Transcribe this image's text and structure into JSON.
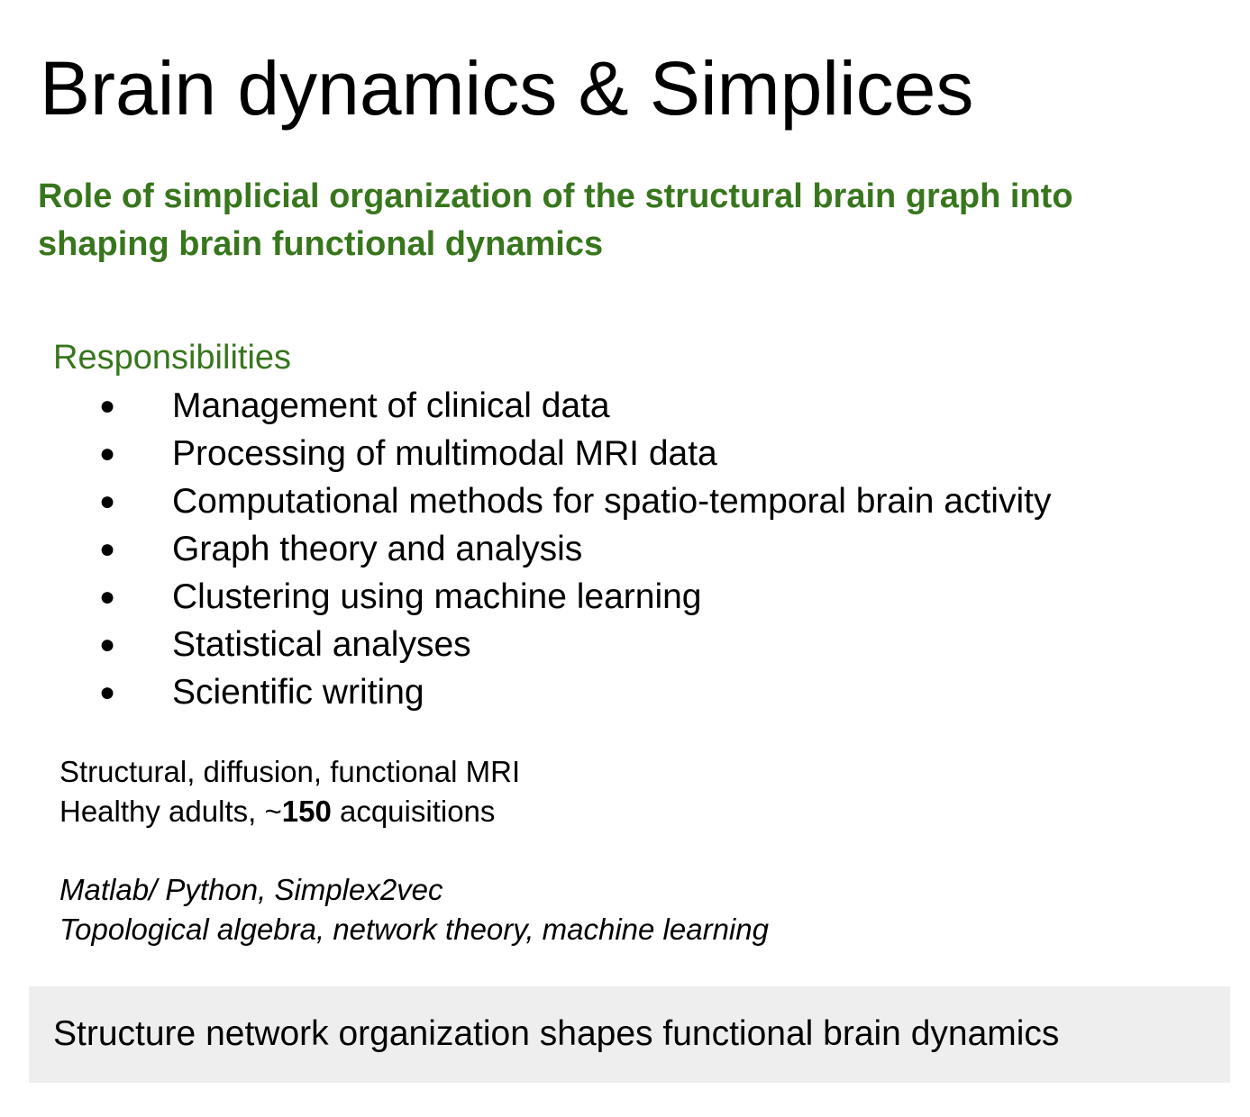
{
  "title": "Brain dynamics & Simplices",
  "subtitle": "Role of simplicial organization of the structural brain graph into shaping brain functional dynamics",
  "responsibilities": {
    "heading": "Responsibilities",
    "bullet": "●",
    "items": [
      "Management of clinical data",
      "Processing of multimodal MRI data",
      "Computational methods for spatio-temporal brain activity",
      "Graph theory and analysis",
      "Clustering using machine learning",
      "Statistical analyses",
      "Scientific writing"
    ]
  },
  "data_info": {
    "modalities": "Structural, diffusion, functional MRI",
    "population_prefix": "Healthy adults, ~",
    "population_count": "150",
    "population_suffix": " acquisitions"
  },
  "tools": {
    "software": "Matlab/ Python, Simplex2vec",
    "methods": "Topological algebra, network theory, machine learning"
  },
  "footer": {
    "text": "Structure network organization shapes functional brain dynamics"
  },
  "colors": {
    "accent_green": "#38761d",
    "footer_background": "#eeeeee"
  }
}
